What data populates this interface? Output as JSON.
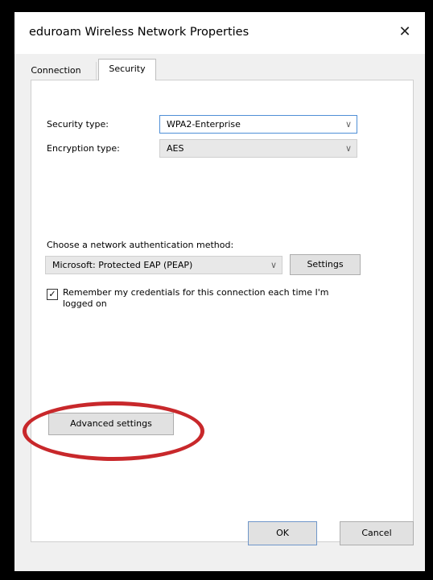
{
  "window": {
    "title": "eduroam Wireless Network Properties",
    "close_glyph": "✕"
  },
  "tabs": [
    {
      "label": "Connection",
      "active": false
    },
    {
      "label": "Security",
      "active": true
    }
  ],
  "security": {
    "security_type_label": "Security type:",
    "security_type_value": "WPA2-Enterprise",
    "encryption_type_label": "Encryption type:",
    "encryption_type_value": "AES",
    "auth_method_label": "Choose a network authentication method:",
    "auth_method_value": "Microsoft: Protected EAP (PEAP)",
    "settings_button": "Settings",
    "remember_credentials_checked": true,
    "remember_credentials_label": "Remember my credentials for this connection each time I'm logged on",
    "advanced_settings_button": "Advanced settings"
  },
  "footer": {
    "ok_button": "OK",
    "cancel_button": "Cancel"
  },
  "annotation": {
    "highlight_color": "#c8282b"
  },
  "icons": {
    "chevron": "chevron-down-icon",
    "check": "checkmark-icon"
  }
}
